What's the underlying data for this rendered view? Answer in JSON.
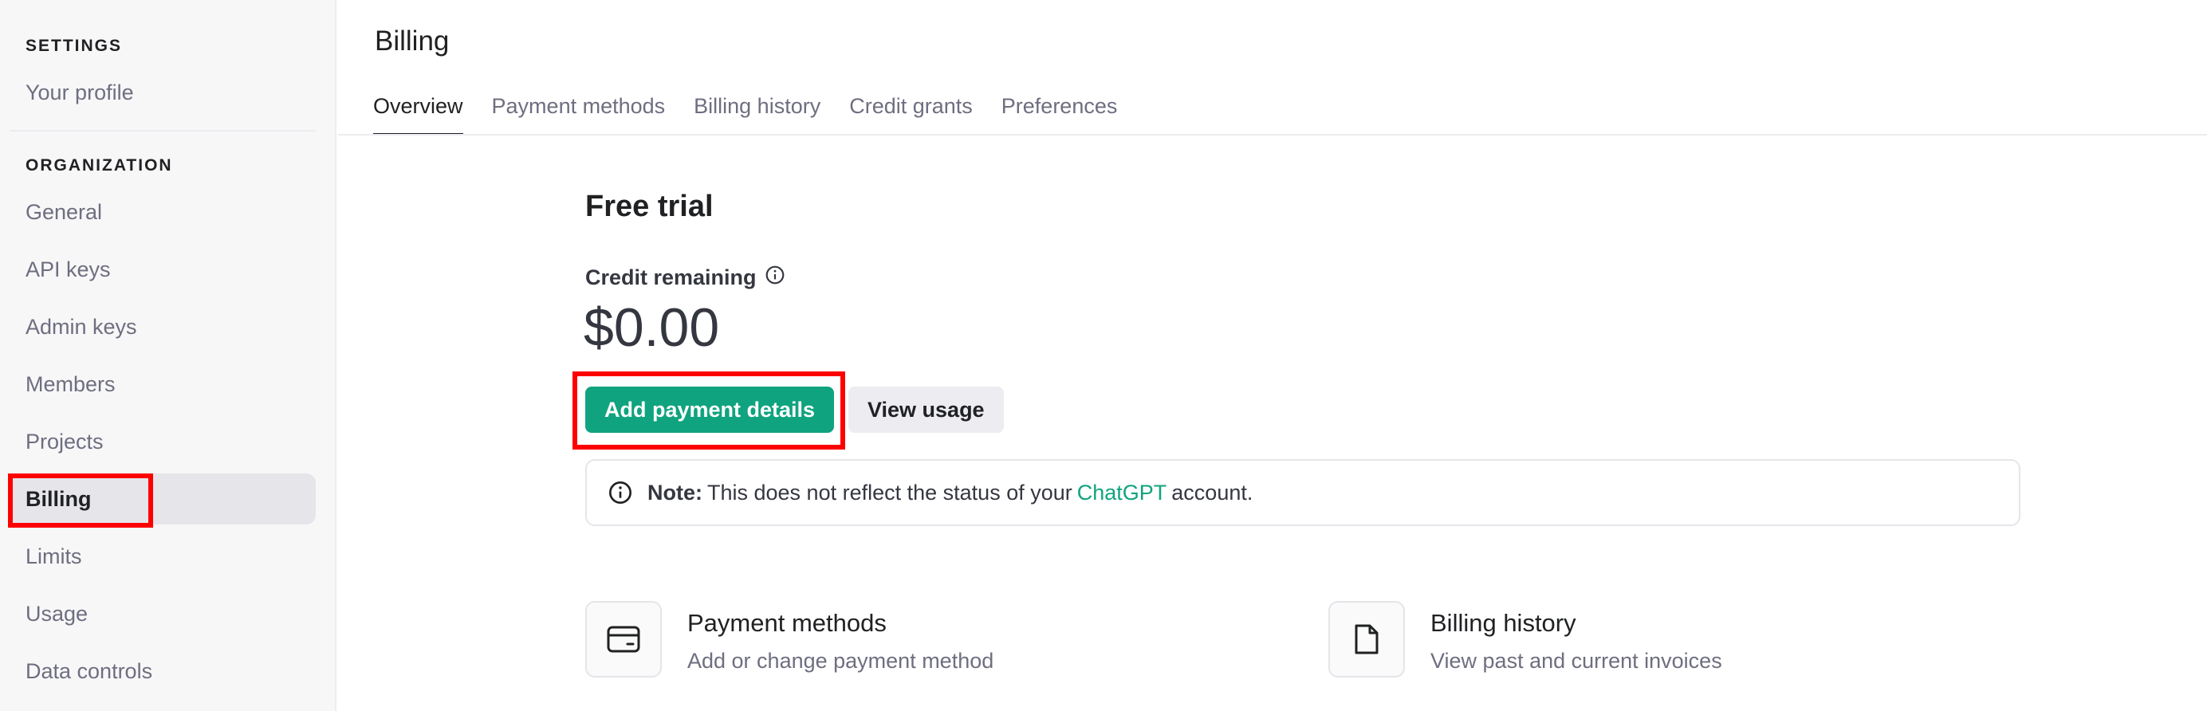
{
  "sidebar": {
    "settings_heading": "SETTINGS",
    "settings_items": [
      {
        "label": "Your profile"
      }
    ],
    "org_heading": "ORGANIZATION",
    "org_items": [
      {
        "label": "General"
      },
      {
        "label": "API keys"
      },
      {
        "label": "Admin keys"
      },
      {
        "label": "Members"
      },
      {
        "label": "Projects"
      },
      {
        "label": "Billing",
        "active": true
      },
      {
        "label": "Limits"
      },
      {
        "label": "Usage"
      },
      {
        "label": "Data controls"
      }
    ]
  },
  "main": {
    "title": "Billing",
    "tabs": [
      {
        "label": "Overview",
        "active": true
      },
      {
        "label": "Payment methods"
      },
      {
        "label": "Billing history"
      },
      {
        "label": "Credit grants"
      },
      {
        "label": "Preferences"
      }
    ],
    "plan_title": "Free trial",
    "credit_label": "Credit remaining",
    "credit_value": "$0.00",
    "add_payment_label": "Add payment details",
    "view_usage_label": "View usage",
    "note": {
      "prefix": "Note:",
      "text_before": "This does not reflect the status of your",
      "link": "ChatGPT",
      "text_after": "account."
    },
    "cards": [
      {
        "title": "Payment methods",
        "desc": "Add or change payment method",
        "icon": "credit-card-icon"
      },
      {
        "title": "Billing history",
        "desc": "View past and current invoices",
        "icon": "document-icon"
      }
    ]
  },
  "colors": {
    "accent": "#10a37f",
    "highlight": "#ff0000"
  }
}
